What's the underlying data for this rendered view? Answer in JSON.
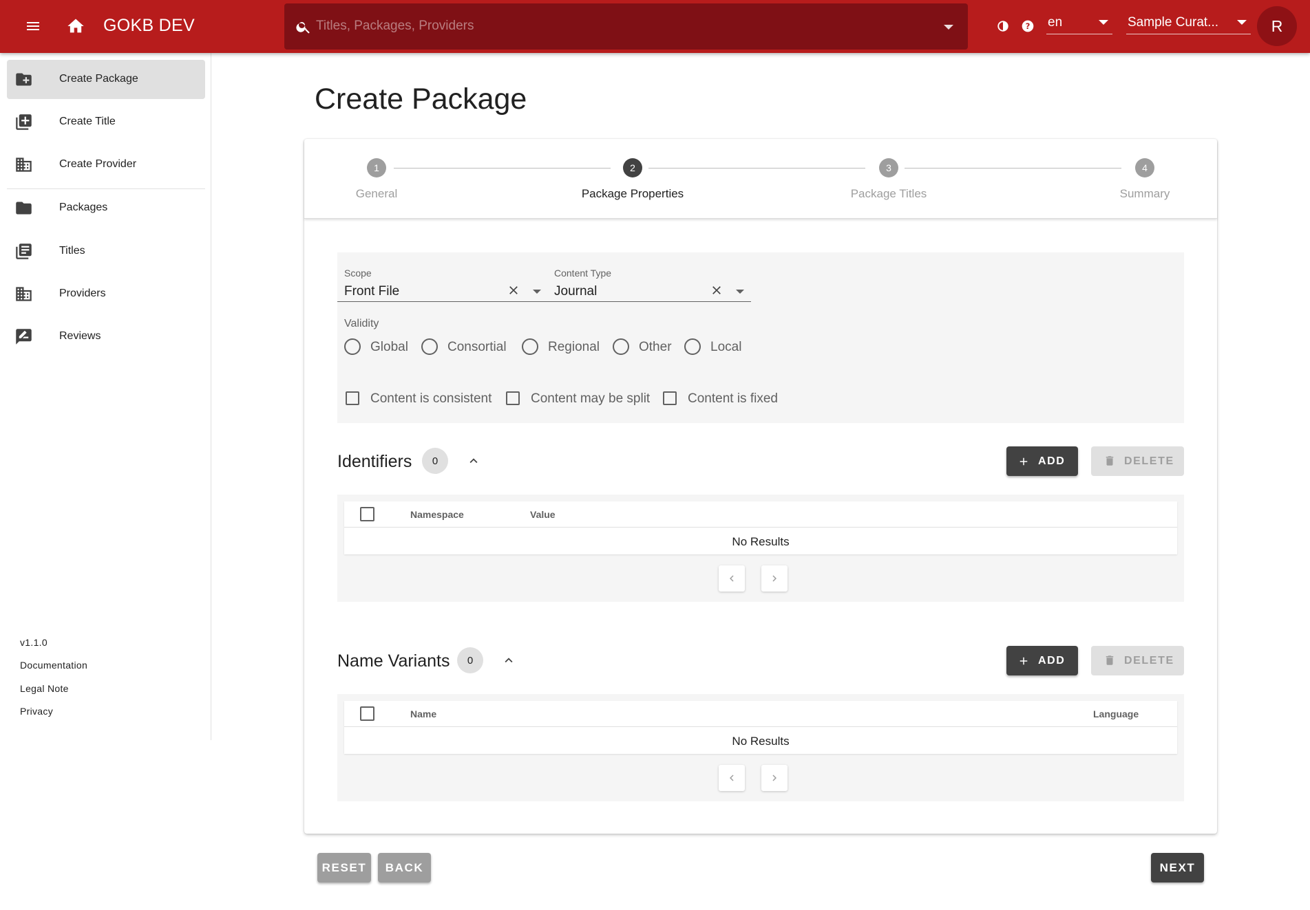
{
  "app": {
    "title": "GOKB DEV",
    "search_placeholder": "Titles, Packages, Providers",
    "language": "en",
    "user": "Sample Curat...",
    "avatar_initial": "R",
    "brand_color": "#b71c1c"
  },
  "sidebar": {
    "items": [
      {
        "label": "Create Package",
        "icon": "add-folder-icon",
        "active": true
      },
      {
        "label": "Create Title",
        "icon": "add-library-icon"
      },
      {
        "label": "Create Provider",
        "icon": "domain-icon"
      },
      {
        "label": "Packages",
        "icon": "folder-icon"
      },
      {
        "label": "Titles",
        "icon": "library-books-icon"
      },
      {
        "label": "Providers",
        "icon": "domain-icon"
      },
      {
        "label": "Reviews",
        "icon": "rate-review-icon"
      }
    ],
    "footer": {
      "version": "v1.1.0",
      "documentation": "Documentation",
      "legal_note": "Legal Note",
      "privacy": "Privacy"
    }
  },
  "main": {
    "page_title": "Create Package",
    "steps": [
      {
        "number": "1",
        "label": "General"
      },
      {
        "number": "2",
        "label": "Package Properties",
        "active": true
      },
      {
        "number": "3",
        "label": "Package Titles"
      },
      {
        "number": "4",
        "label": "Summary"
      }
    ],
    "form": {
      "scope": {
        "label": "Scope",
        "value": "Front File"
      },
      "content_type": {
        "label": "Content Type",
        "value": "Journal"
      },
      "validity_label": "Validity",
      "validity_options": [
        "Global",
        "Consortial",
        "Regional",
        "Other",
        "Local"
      ],
      "checkboxes": [
        "Content is consistent",
        "Content may be split",
        "Content is fixed"
      ]
    },
    "identifiers": {
      "title": "Identifiers",
      "count": "0",
      "add_label": "ADD",
      "delete_label": "DELETE",
      "columns": [
        "Namespace",
        "Value"
      ],
      "empty_text": "No Results"
    },
    "name_variants": {
      "title": "Name Variants",
      "count": "0",
      "add_label": "ADD",
      "delete_label": "DELETE",
      "columns": [
        "Name",
        "Language"
      ],
      "empty_text": "No Results"
    },
    "actions": {
      "reset": "RESET",
      "back": "BACK",
      "next": "NEXT"
    }
  }
}
